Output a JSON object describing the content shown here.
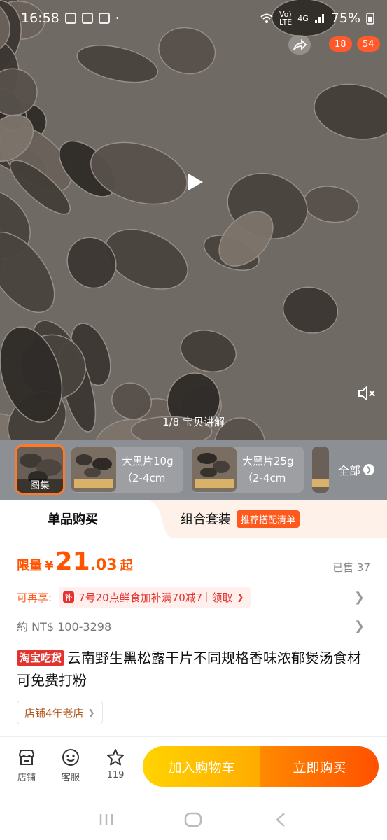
{
  "status_bar": {
    "time": "16:58",
    "volte_top": "Vo)",
    "volte_bottom": "LTE",
    "network": "4G",
    "battery": "75%"
  },
  "hero": {
    "badge_cart_count": "18",
    "badge_message_count": "54",
    "caption": "1/8 宝贝讲解"
  },
  "thumbnails": {
    "gallery_label": "图集",
    "sku_cards": [
      {
        "label": "大黑片10g（2-4cm"
      },
      {
        "label": "大黑片25g（2-4cm"
      }
    ],
    "all_label": "全部"
  },
  "tabs": {
    "single_buy": "单品购买",
    "combo": "组合套装",
    "combo_tag": "推荐搭配清单"
  },
  "price": {
    "label": "限量",
    "currency": "¥",
    "integer": "21",
    "decimal": ".03",
    "suffix": "起",
    "sold": "已售 37"
  },
  "promo": {
    "label": "可再享:",
    "icon": "补",
    "text": "7号20点鲜食加补满70减7",
    "action": "领取"
  },
  "ntd_price": "約 NT$ 100-3298",
  "product": {
    "tag": "淘宝吃货",
    "title": "云南野生黑松露干片不同规格香味浓郁煲汤食材可免费打粉"
  },
  "shop_age": "店铺4年老店",
  "bottom_bar": {
    "store": "店铺",
    "service": "客服",
    "favorites": "119",
    "add_to_cart": "加入购物车",
    "buy_now": "立即购买"
  },
  "colors": {
    "accent": "#ff5500",
    "cart_button": "#ffab00",
    "buy_button": "#ff5000",
    "promo_red": "#e4322f"
  }
}
